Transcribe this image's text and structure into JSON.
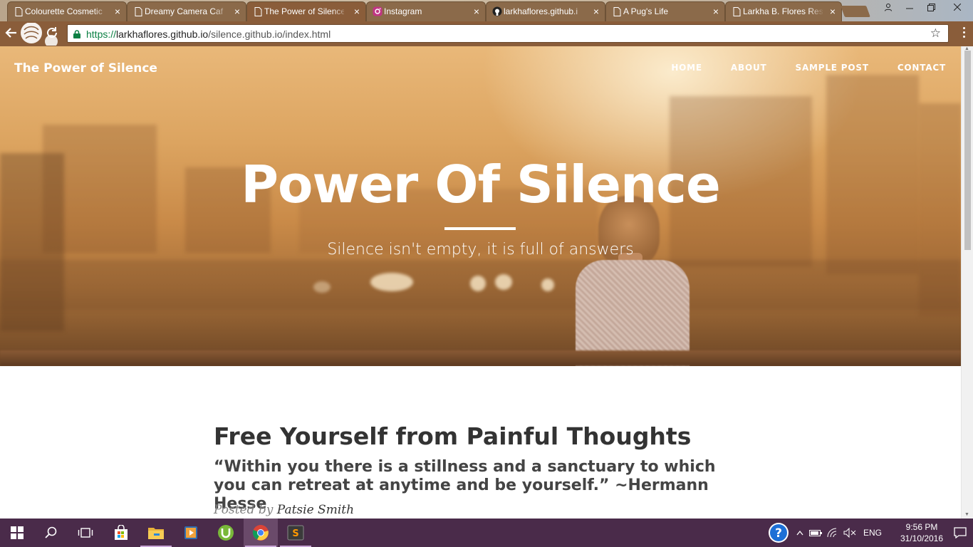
{
  "browser": {
    "tabs": [
      {
        "title": "Colourette Cosmetic",
        "icon": "document-icon",
        "active": false
      },
      {
        "title": "Dreamy Camera Caf",
        "icon": "document-icon",
        "active": false
      },
      {
        "title": "The Power of Silence",
        "icon": "document-icon",
        "active": true
      },
      {
        "title": "Instagram",
        "icon": "instagram-icon",
        "active": false
      },
      {
        "title": "larkhaflores.github.i",
        "icon": "github-icon",
        "active": false
      },
      {
        "title": "A Pug's Life",
        "icon": "document-icon",
        "active": false
      },
      {
        "title": "Larkha B. Flores Res",
        "icon": "document-icon",
        "active": false
      }
    ],
    "close_glyph": "×",
    "address": {
      "protocol": "https://",
      "host": "larkhaflores.github.io",
      "path": "/silence.github.io/index.html"
    }
  },
  "site": {
    "brand": "The Power of Silence",
    "nav": [
      "HOME",
      "ABOUT",
      "SAMPLE POST",
      "CONTACT"
    ],
    "hero": {
      "title": "Power Of Silence",
      "subtitle": "Silence isn't empty, it is full of answers"
    },
    "post": {
      "title": "Free Yourself from Painful Thoughts",
      "subtitle": "“Within you there is a stillness and a sanctuary to which you can retreat at anytime and be yourself.” ~Hermann Hesse",
      "posted_by_label": "Posted by",
      "author": "Patsie Smith"
    }
  },
  "taskbar": {
    "apps": [
      "start-icon",
      "search-icon",
      "task-view-icon",
      "store-icon",
      "file-explorer-icon",
      "media-player-icon",
      "utorrent-icon",
      "chrome-icon",
      "sublime-text-icon"
    ],
    "tray": {
      "language": "ENG",
      "time": "9:56 PM",
      "date": "31/10/2016"
    }
  },
  "colors": {
    "tab_bg": "#8b6a4a",
    "toolbar_bg": "#8a5d3a",
    "taskbar_bg": "#4a2b4a",
    "secure_green": "#0b8043"
  }
}
